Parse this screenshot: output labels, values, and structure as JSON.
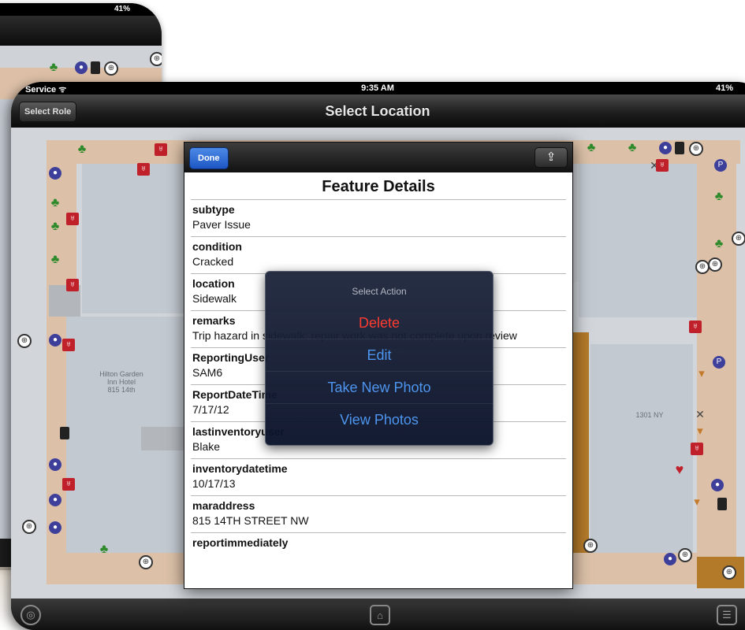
{
  "back_device": {
    "status_text": "41% "
  },
  "status_bar": {
    "carrier": "Service ᯤ",
    "time": "9:35 AM",
    "battery": "41%"
  },
  "nav": {
    "title": "Select Location",
    "role_button": "Select Role"
  },
  "map": {
    "building_labels": [
      "Hilton Garden\nInn Hotel\n815 14th",
      "1301 NY"
    ]
  },
  "popover": {
    "done_label": "Done",
    "share_icon": "share-icon",
    "title": "Feature Details",
    "fields": [
      {
        "key": "subtype",
        "value": "Paver Issue"
      },
      {
        "key": "condition",
        "value": "Cracked"
      },
      {
        "key": "location",
        "value": "Sidewalk"
      },
      {
        "key": "remarks",
        "value": "Trip hazard in sidewalk; repair work was not complete upon review"
      },
      {
        "key": "ReportingUser",
        "value": "SAM6"
      },
      {
        "key": "ReportDateTime",
        "value": "7/17/12"
      },
      {
        "key": "lastinventoryuser",
        "value": "Blake"
      },
      {
        "key": "inventorydatetime",
        "value": "10/17/13"
      },
      {
        "key": "maraddress",
        "value": "815 14TH STREET NW"
      },
      {
        "key": "reportimmediately",
        "value": ""
      }
    ]
  },
  "action_sheet": {
    "title": "Select Action",
    "options": [
      "Delete",
      "Edit",
      "Take New Photo",
      "View Photos"
    ]
  },
  "tabbar": {
    "left_icon": "locate-icon",
    "center_icon": "home-icon",
    "right_icon": "list-icon"
  },
  "colors": {
    "accent_blue": "#4d95ee",
    "delete_red": "#ff3b30",
    "done_blue": "#2a63d1"
  }
}
